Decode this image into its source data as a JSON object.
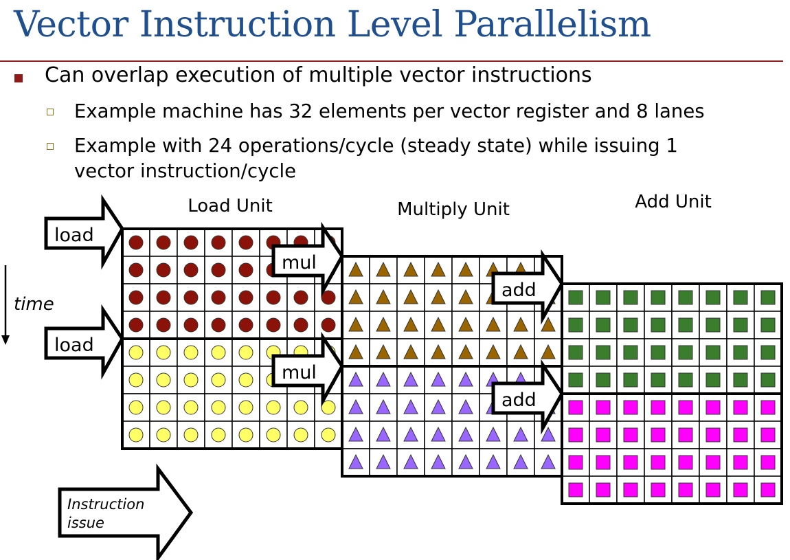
{
  "title": "Vector Instruction Level Parallelism",
  "bullets": [
    {
      "text": "Can overlap execution of multiple vector instructions",
      "sub": [
        {
          "lines": [
            "Example machine has 32 elements per vector register and 8 lanes"
          ]
        },
        {
          "lines": [
            "Example with 24 operations/cycle (steady state) while issuing 1",
            "vector instruction/cycle"
          ]
        }
      ]
    }
  ],
  "diagram": {
    "units": [
      "Load Unit",
      "Multiply Unit",
      "Add Unit"
    ],
    "instructions": [
      "load",
      "mul",
      "add"
    ],
    "time_label": "time",
    "issue_label": [
      "Instruction",
      "issue"
    ],
    "lanes": 8,
    "rows_per_instruction": 4,
    "colors": {
      "load_1": "#8b1208",
      "load_2": "#ffff66",
      "mul_1": "#9a6500",
      "mul_2": "#9966ff",
      "add_1": "#3a7d2c",
      "add_2": "#ff00ff",
      "title": "#1f4f8f",
      "rule": "#8e1b17"
    },
    "shapes": {
      "load": "circle",
      "mul": "triangle",
      "add": "square"
    }
  }
}
